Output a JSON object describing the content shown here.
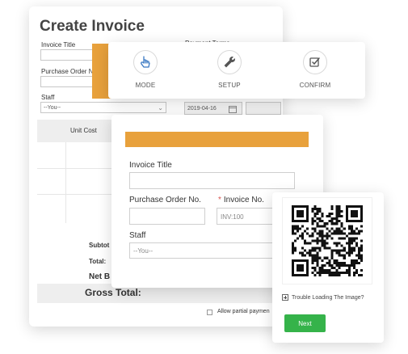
{
  "invoice_form": {
    "title": "Create Invoice",
    "invoice_title_label": "Invoice Title",
    "payment_terms_label": "Payment Terms",
    "po_label": "Purchase Order No.",
    "staff_label": "Staff",
    "staff_value": "--You--",
    "date_value": "2019-04-16",
    "columns": {
      "unit_cost": "Unit Cost",
      "qty": "Q"
    },
    "subtotal_label": "Subtot",
    "total_label": "Total:",
    "net_label": "Net B",
    "gross_label": "Gross Total:",
    "partial_payment_label": "Allow partial paymen"
  },
  "steps": [
    {
      "label": "MODE",
      "icon": "pointer-hand-icon"
    },
    {
      "label": "SETUP",
      "icon": "wrench-icon"
    },
    {
      "label": "CONFIRM",
      "icon": "checkbox-icon"
    }
  ],
  "front_form": {
    "invoice_title_label": "Invoice Title",
    "po_label": "Purchase Order No.",
    "invoice_no_required_mark": "*",
    "invoice_no_label": "Invoice No.",
    "invoice_no_placeholder": "INV:100",
    "staff_label": "Staff",
    "staff_value": "--You--"
  },
  "qr": {
    "help_text": "Trouble Loading The Image?",
    "next_label": "Next"
  },
  "colors": {
    "accent_orange": "#e8a13c",
    "next_green": "#35b34a",
    "icon_blue": "#3a78c2"
  }
}
